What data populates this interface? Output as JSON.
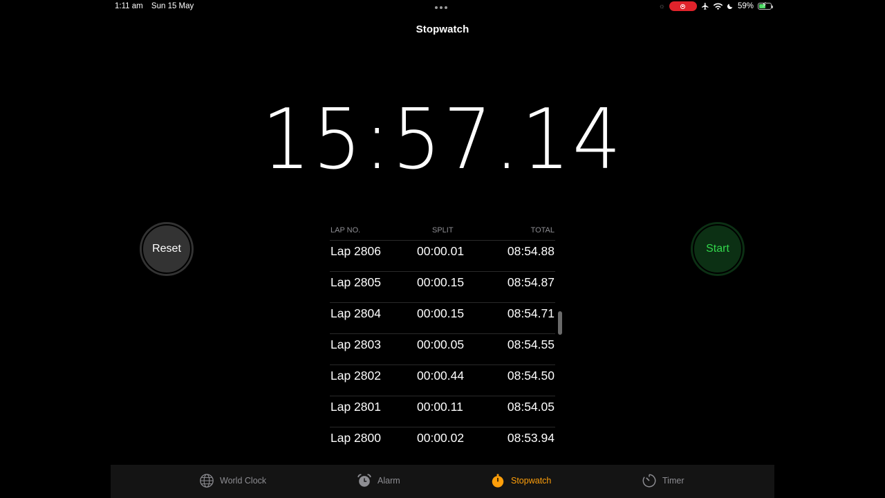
{
  "status_bar": {
    "time": "1:11 am",
    "date": "Sun 15 May",
    "battery": "59%",
    "battery_level": 0.59
  },
  "nav": {
    "title": "Stopwatch"
  },
  "stopwatch": {
    "display": "15:57.14"
  },
  "buttons": {
    "reset": "Reset",
    "start": "Start"
  },
  "laps": {
    "headers": {
      "lap_no": "LAP NO.",
      "split": "SPLIT",
      "total": "TOTAL"
    },
    "rows": [
      {
        "lap": "Lap 2806",
        "split": "00:00.01",
        "total": "08:54.88"
      },
      {
        "lap": "Lap 2805",
        "split": "00:00.15",
        "total": "08:54.87"
      },
      {
        "lap": "Lap 2804",
        "split": "00:00.15",
        "total": "08:54.71"
      },
      {
        "lap": "Lap 2803",
        "split": "00:00.05",
        "total": "08:54.55"
      },
      {
        "lap": "Lap 2802",
        "split": "00:00.44",
        "total": "08:54.50"
      },
      {
        "lap": "Lap 2801",
        "split": "00:00.11",
        "total": "08:54.05"
      },
      {
        "lap": "Lap 2800",
        "split": "00:00.02",
        "total": "08:53.94"
      }
    ]
  },
  "tabs": [
    {
      "label": "World Clock",
      "icon": "globe-icon",
      "active": false
    },
    {
      "label": "Alarm",
      "icon": "alarm-icon",
      "active": false
    },
    {
      "label": "Stopwatch",
      "icon": "stopwatch-icon",
      "active": true
    },
    {
      "label": "Timer",
      "icon": "timer-icon",
      "active": false
    }
  ],
  "colors": {
    "accent_orange": "#ff9f0a",
    "start_green": "#32d74b",
    "start_bg": "#0c3014",
    "reset_bg": "#333333",
    "record_red": "#e0232b"
  }
}
